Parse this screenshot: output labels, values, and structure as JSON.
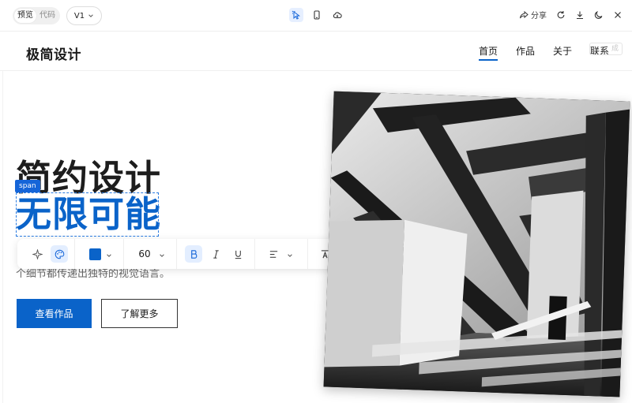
{
  "topbar": {
    "view_modes": [
      "预览",
      "代码"
    ],
    "active_view": "预览",
    "version": "V1",
    "share_label": "分享",
    "icons": {
      "center": [
        "cursor-select-icon",
        "mobile-icon",
        "cloud-sync-icon"
      ],
      "right": [
        "refresh-icon",
        "download-icon",
        "dark-mode-icon",
        "close-icon"
      ]
    }
  },
  "site": {
    "brand": "极简设计",
    "nav": [
      "首页",
      "作品",
      "关于",
      "联系"
    ],
    "active_nav": "首页",
    "ghost_button": "成"
  },
  "hero": {
    "line1": "简约设计",
    "line2": "无限可能",
    "selected_tag": "span",
    "description": "个细节都传递出独特的视觉语言。",
    "primary_button": "查看作品",
    "secondary_button": "了解更多"
  },
  "format_toolbar": {
    "text_color": "#0a63c9",
    "font_size": "60",
    "line_height": "60",
    "active_tool": "palette",
    "bold_active": true
  },
  "colors": {
    "accent": "#0a63c9",
    "text": "#1d1d1d",
    "muted": "#666666"
  }
}
